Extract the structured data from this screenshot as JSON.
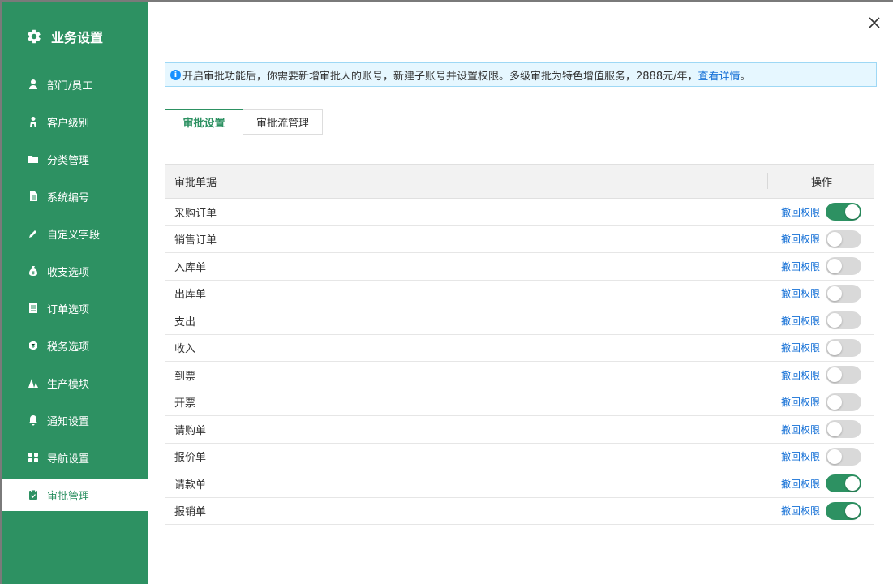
{
  "sidebar": {
    "title": "业务设置",
    "items": [
      {
        "label": "部门/员工",
        "icon": "user-icon",
        "active": false
      },
      {
        "label": "客户级别",
        "icon": "person-icon",
        "active": false
      },
      {
        "label": "分类管理",
        "icon": "folder-icon",
        "active": false
      },
      {
        "label": "系统编号",
        "icon": "document-icon",
        "active": false
      },
      {
        "label": "自定义字段",
        "icon": "edit-icon",
        "active": false
      },
      {
        "label": "收支选项",
        "icon": "money-bag-icon",
        "active": false
      },
      {
        "label": "订单选项",
        "icon": "list-icon",
        "active": false
      },
      {
        "label": "税务选项",
        "icon": "tax-icon",
        "active": false
      },
      {
        "label": "生产模块",
        "icon": "production-icon",
        "active": false
      },
      {
        "label": "通知设置",
        "icon": "bell-icon",
        "active": false
      },
      {
        "label": "导航设置",
        "icon": "grid-icon",
        "active": false
      },
      {
        "label": "审批管理",
        "icon": "clipboard-check-icon",
        "active": true
      }
    ]
  },
  "notice": {
    "text": "开启审批功能后，你需要新增审批人的账号，新建子账号并设置权限。多级审批为特色增值服务，2888元/年，",
    "link": "查看详情",
    "suffix": " 。"
  },
  "tabs": [
    "审批设置",
    "审批流管理"
  ],
  "table": {
    "col_doc": "审批单据",
    "col_action": "操作",
    "rows": [
      {
        "name": "采购订单",
        "action": "撤回权限",
        "enabled": true
      },
      {
        "name": "销售订单",
        "action": "撤回权限",
        "enabled": false
      },
      {
        "name": "入库单",
        "action": "撤回权限",
        "enabled": false
      },
      {
        "name": "出库单",
        "action": "撤回权限",
        "enabled": false
      },
      {
        "name": "支出",
        "action": "撤回权限",
        "enabled": false
      },
      {
        "name": "收入",
        "action": "撤回权限",
        "enabled": false
      },
      {
        "name": "到票",
        "action": "撤回权限",
        "enabled": false
      },
      {
        "name": "开票",
        "action": "撤回权限",
        "enabled": false
      },
      {
        "name": "请购单",
        "action": "撤回权限",
        "enabled": false
      },
      {
        "name": "报价单",
        "action": "撤回权限",
        "enabled": false
      },
      {
        "name": "请款单",
        "action": "撤回权限",
        "enabled": true
      },
      {
        "name": "报销单",
        "action": "撤回权限",
        "enabled": true
      }
    ]
  },
  "colors": {
    "accent": "#2d9162",
    "link": "#1570d6",
    "info": "#1890ff"
  }
}
